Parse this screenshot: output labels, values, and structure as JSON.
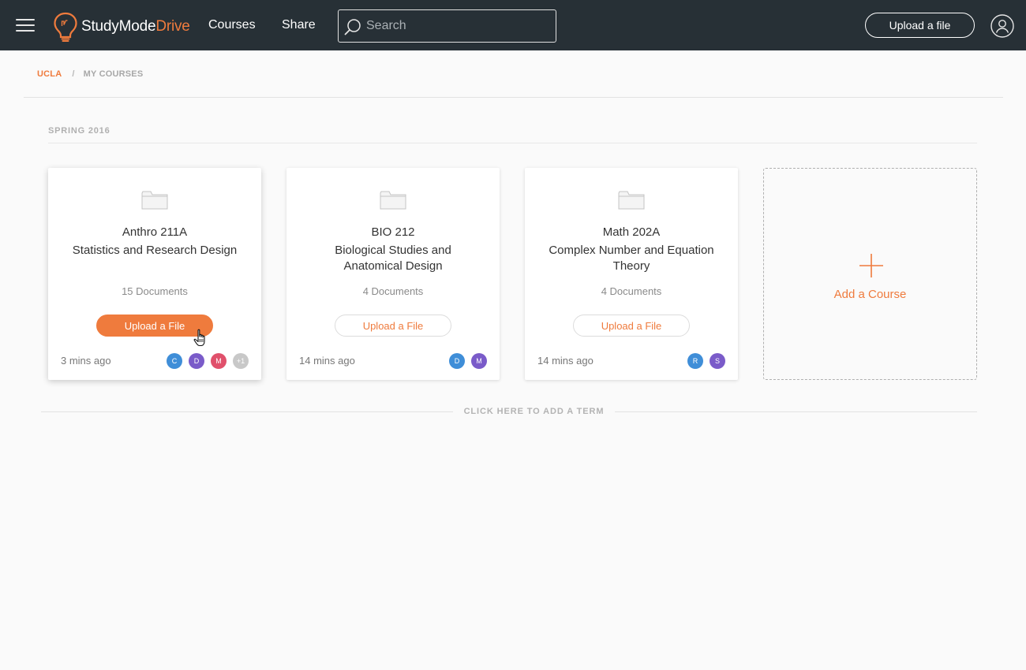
{
  "header": {
    "logo_main": "StudyMode",
    "logo_accent": "Drive",
    "nav": {
      "courses": "Courses",
      "share": "Share"
    },
    "search_placeholder": "Search",
    "upload_label": "Upload a file"
  },
  "breadcrumb": {
    "school": "UCLA",
    "separator": "/",
    "current": "MY COURSES"
  },
  "term": {
    "title": "SPRING 2016",
    "courses": [
      {
        "code": "Anthro 211A",
        "name": "Statistics and Research Design",
        "documents": "15 Documents",
        "upload_label": "Upload a File",
        "updated": "3 mins ago",
        "avatars": [
          {
            "initial": "C",
            "color": "#3f8ed8"
          },
          {
            "initial": "D",
            "color": "#7a5bc9"
          },
          {
            "initial": "M",
            "color": "#e0506b"
          },
          {
            "initial": "+1",
            "color": "#c8c8c8"
          }
        ]
      },
      {
        "code": "BIO 212",
        "name": "Biological Studies and Anatomical Design",
        "documents": "4 Documents",
        "upload_label": "Upload a File",
        "updated": "14 mins ago",
        "avatars": [
          {
            "initial": "D",
            "color": "#3f8ed8"
          },
          {
            "initial": "M",
            "color": "#7a5bc9"
          }
        ]
      },
      {
        "code": "Math 202A",
        "name": "Complex Number and Equation Theory",
        "documents": "4 Documents",
        "upload_label": "Upload a File",
        "updated": "14 mins ago",
        "avatars": [
          {
            "initial": "R",
            "color": "#3f8ed8"
          },
          {
            "initial": "S",
            "color": "#7a5bc9"
          }
        ]
      }
    ],
    "add_course_label": "Add a Course"
  },
  "add_term_label": "CLICK HERE TO ADD A TERM",
  "colors": {
    "accent": "#ef7b3d",
    "topbar": "#273036"
  }
}
